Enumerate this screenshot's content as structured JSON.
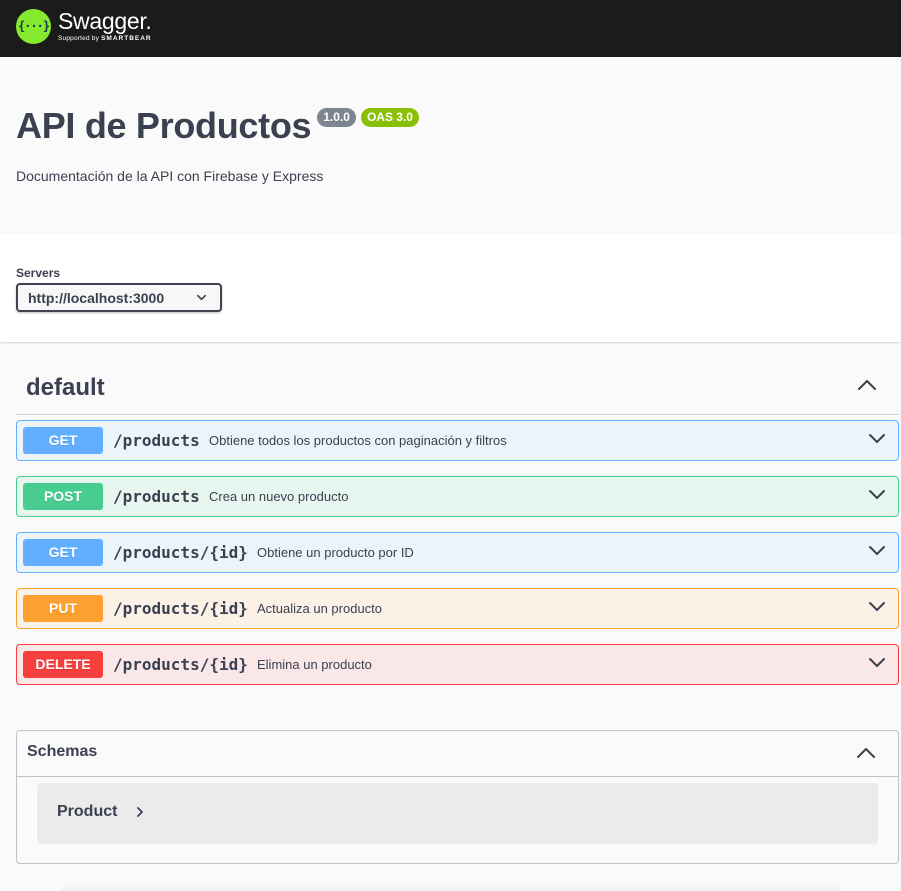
{
  "topbar": {
    "brand_icon_text": "{···}",
    "brand_name": "Swagger.",
    "brand_sub_prefix": "Supported by",
    "brand_sub_company": "SMARTBEAR"
  },
  "info": {
    "title": "API de Productos",
    "version": "1.0.0",
    "oas": "OAS 3.0",
    "description": "Documentación de la API con Firebase y Express"
  },
  "servers": {
    "label": "Servers",
    "selected": "http://localhost:3000"
  },
  "tag": {
    "name": "default"
  },
  "operations": [
    {
      "method": "GET",
      "path": "/products",
      "summary": "Obtiene todos los productos con paginación y filtros"
    },
    {
      "method": "POST",
      "path": "/products",
      "summary": "Crea un nuevo producto"
    },
    {
      "method": "GET",
      "path": "/products/{id}",
      "summary": "Obtiene un producto por ID"
    },
    {
      "method": "PUT",
      "path": "/products/{id}",
      "summary": "Actualiza un producto"
    },
    {
      "method": "DELETE",
      "path": "/products/{id}",
      "summary": "Elimina un producto"
    }
  ],
  "schemas": {
    "title": "Schemas",
    "models": [
      {
        "name": "Product"
      }
    ]
  },
  "colors": {
    "get": "#61affe",
    "post": "#49cc90",
    "put": "#fca130",
    "delete": "#f93e3e",
    "brand_green": "#85ea2d",
    "topbar_bg": "#1b1b1b"
  }
}
